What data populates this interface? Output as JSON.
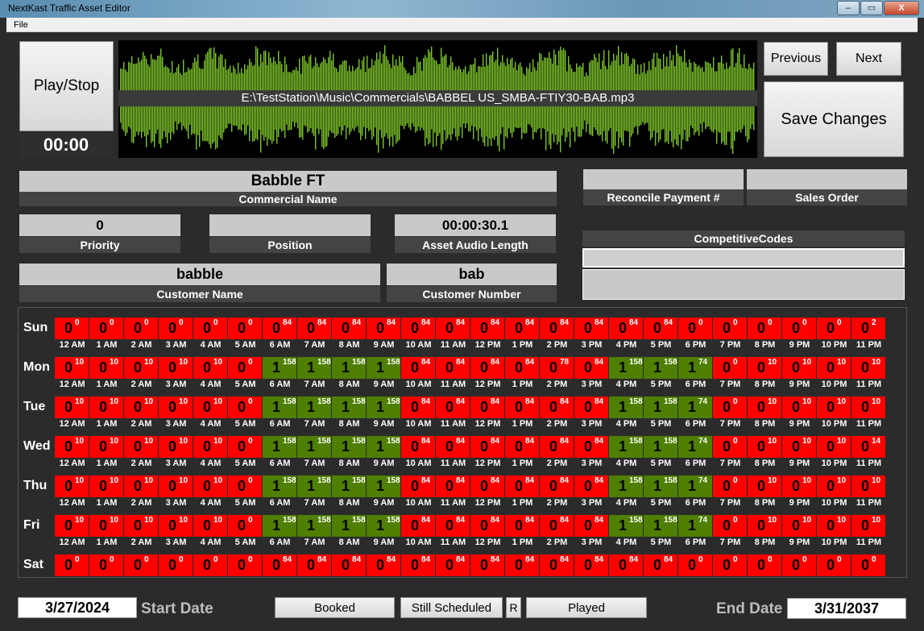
{
  "window": {
    "title": "NextKast Traffic Asset Editor",
    "minimize": "–",
    "maximize": "▭",
    "close": "X"
  },
  "menu": {
    "file": "File"
  },
  "player": {
    "play_stop": "Play/Stop",
    "time": "00:00",
    "file_path": "E:\\TestStation\\Music\\Commercials\\BABBEL US_SMBA-FTIY30-BAB.mp3",
    "waveform_color": "#7ec42a"
  },
  "nav": {
    "previous": "Previous",
    "next": "Next",
    "save": "Save Changes"
  },
  "fields": {
    "commercial_name": {
      "value": "Babble FT",
      "label": "Commercial Name"
    },
    "reconcile_payment": {
      "value": "",
      "label": "Reconcile Payment #"
    },
    "sales_order": {
      "value": "",
      "label": "Sales Order"
    },
    "priority": {
      "value": "0",
      "label": "Priority"
    },
    "position": {
      "value": "",
      "label": "Position"
    },
    "audio_length": {
      "value": "00:00:30.1",
      "label": "Asset Audio Length"
    },
    "customer_name": {
      "value": "babble",
      "label": "Customer Name"
    },
    "customer_number": {
      "value": "bab",
      "label": "Customer Number"
    },
    "competitive_codes": {
      "label": "CompetitiveCodes",
      "value": ""
    }
  },
  "colors": {
    "off": "#ff0000",
    "on": "#4f7f00"
  },
  "hours": [
    "12 AM",
    "1 AM",
    "2 AM",
    "3 AM",
    "4 AM",
    "5 AM",
    "6 AM",
    "7 AM",
    "8 AM",
    "9 AM",
    "10 AM",
    "11 AM",
    "12 PM",
    "1 PM",
    "2 PM",
    "3 PM",
    "4 PM",
    "5 PM",
    "6 PM",
    "7 PM",
    "8 PM",
    "9 PM",
    "10 PM",
    "11 PM"
  ],
  "schedule": [
    {
      "day": "Sun",
      "show_hours": true,
      "active": [
        0,
        0,
        0,
        0,
        0,
        0,
        0,
        0,
        0,
        0,
        0,
        0,
        0,
        0,
        0,
        0,
        0,
        0,
        0,
        0,
        0,
        0,
        0,
        0
      ],
      "counts": [
        0,
        0,
        0,
        0,
        0,
        0,
        84,
        84,
        84,
        84,
        84,
        84,
        84,
        84,
        84,
        84,
        84,
        84,
        0,
        0,
        0,
        0,
        0,
        2
      ]
    },
    {
      "day": "Mon",
      "show_hours": true,
      "active": [
        0,
        0,
        0,
        0,
        0,
        0,
        1,
        1,
        1,
        1,
        0,
        0,
        0,
        0,
        0,
        0,
        1,
        1,
        1,
        0,
        0,
        0,
        0,
        0
      ],
      "counts": [
        10,
        10,
        10,
        10,
        10,
        0,
        158,
        158,
        158,
        158,
        84,
        84,
        84,
        84,
        78,
        84,
        158,
        158,
        74,
        0,
        10,
        10,
        10,
        10
      ]
    },
    {
      "day": "Tue",
      "show_hours": true,
      "active": [
        0,
        0,
        0,
        0,
        0,
        0,
        1,
        1,
        1,
        1,
        0,
        0,
        0,
        0,
        0,
        0,
        1,
        1,
        1,
        0,
        0,
        0,
        0,
        0
      ],
      "counts": [
        10,
        10,
        10,
        10,
        10,
        0,
        158,
        158,
        158,
        158,
        84,
        84,
        84,
        84,
        84,
        84,
        158,
        158,
        74,
        0,
        10,
        10,
        10,
        10
      ]
    },
    {
      "day": "Wed",
      "show_hours": true,
      "active": [
        0,
        0,
        0,
        0,
        0,
        0,
        1,
        1,
        1,
        1,
        0,
        0,
        0,
        0,
        0,
        0,
        1,
        1,
        1,
        0,
        0,
        0,
        0,
        0
      ],
      "counts": [
        10,
        10,
        10,
        10,
        10,
        0,
        158,
        158,
        158,
        158,
        84,
        84,
        84,
        84,
        84,
        84,
        158,
        158,
        74,
        0,
        10,
        10,
        10,
        14
      ]
    },
    {
      "day": "Thu",
      "show_hours": true,
      "active": [
        0,
        0,
        0,
        0,
        0,
        0,
        1,
        1,
        1,
        1,
        0,
        0,
        0,
        0,
        0,
        0,
        1,
        1,
        1,
        0,
        0,
        0,
        0,
        0
      ],
      "counts": [
        10,
        10,
        10,
        10,
        10,
        0,
        158,
        158,
        158,
        158,
        84,
        84,
        84,
        84,
        84,
        84,
        158,
        158,
        74,
        0,
        10,
        10,
        10,
        10
      ]
    },
    {
      "day": "Fri",
      "show_hours": true,
      "active": [
        0,
        0,
        0,
        0,
        0,
        0,
        1,
        1,
        1,
        1,
        0,
        0,
        0,
        0,
        0,
        0,
        1,
        1,
        1,
        0,
        0,
        0,
        0,
        0
      ],
      "counts": [
        10,
        10,
        10,
        10,
        10,
        0,
        158,
        158,
        158,
        158,
        84,
        84,
        84,
        84,
        84,
        84,
        158,
        158,
        74,
        0,
        10,
        10,
        10,
        10
      ]
    },
    {
      "day": "Sat",
      "show_hours": false,
      "active": [
        0,
        0,
        0,
        0,
        0,
        0,
        0,
        0,
        0,
        0,
        0,
        0,
        0,
        0,
        0,
        0,
        0,
        0,
        0,
        0,
        0,
        0,
        0,
        0
      ],
      "counts": [
        0,
        0,
        0,
        0,
        0,
        0,
        84,
        84,
        84,
        84,
        84,
        84,
        84,
        84,
        84,
        84,
        84,
        84,
        0,
        0,
        0,
        0,
        0,
        0
      ]
    }
  ],
  "footer": {
    "start_date": "3/27/2024",
    "start_label": "Start Date",
    "booked": "Booked",
    "still_scheduled": "Still Scheduled",
    "r": "R",
    "played": "Played",
    "end_label": "End Date",
    "end_date": "3/31/2037"
  }
}
